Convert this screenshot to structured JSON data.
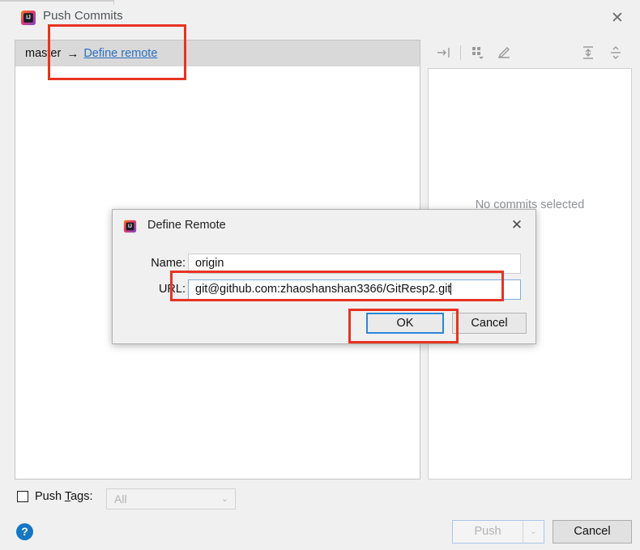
{
  "window": {
    "title": "Push Commits",
    "app_icon": "intellij-idea-icon",
    "close_label": "✕"
  },
  "commits_panel": {
    "branch": {
      "source": "master",
      "arrow": "→",
      "link_label": "Define remote"
    }
  },
  "detail_panel": {
    "empty_message": "No commits selected",
    "toolbar": [
      {
        "name": "collapse-all-icon",
        "glyph": "⇥"
      },
      {
        "name": "group-by-icon",
        "glyph": "∷"
      },
      {
        "name": "edit-icon",
        "glyph": "✎"
      },
      {
        "name": "expand-all-icon",
        "glyph": "⤒"
      },
      {
        "name": "collapse-icon",
        "glyph": "⤓"
      }
    ]
  },
  "bottom_bar": {
    "push_tags_label_pre": "Push ",
    "push_tags_label_mnemonic": "T",
    "push_tags_label_post": "ags:",
    "push_tags_checked": false,
    "tags_combo_value": "All",
    "tags_combo_caret": "⌄",
    "help_label": "?",
    "push_label": "Push",
    "push_caret": "⌄",
    "cancel_label": "Cancel"
  },
  "dialog": {
    "title": "Define Remote",
    "app_icon": "intellij-idea-icon",
    "close_label": "✕",
    "name_label": "Name:",
    "name_value": "origin",
    "url_label": "URL:",
    "url_value": "git@github.com:zhaoshanshan3366/GitResp2.git",
    "ok_label": "OK",
    "cancel_label": "Cancel"
  },
  "annotations": {
    "color": "#e83323",
    "boxes": [
      {
        "name": "annot-define-remote",
        "target": "define-remote-link"
      },
      {
        "name": "annot-url-field",
        "target": "url-input"
      },
      {
        "name": "annot-ok-button",
        "target": "dialog-ok-button"
      }
    ]
  }
}
